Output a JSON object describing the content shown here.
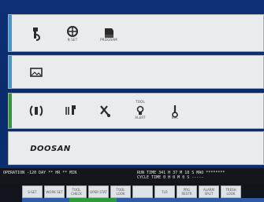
{
  "panels": {
    "top": {
      "icons": [
        {
          "name": "tool-icon",
          "caption": ""
        },
        {
          "name": "network-settings-icon",
          "caption": "N SET"
        },
        {
          "name": "program-icon",
          "caption": "PROGRAM"
        }
      ]
    },
    "display": {
      "icons": [
        {
          "name": "picture-frame-icon",
          "caption": ""
        }
      ]
    },
    "status": {
      "icons": [
        {
          "name": "spindle-icon",
          "caption": ""
        },
        {
          "name": "tool-change-icon",
          "caption": ""
        },
        {
          "name": "coolant-icon",
          "caption": ""
        },
        {
          "name": "light-bulb-icon",
          "caption": "ALERT",
          "caption_top": "TOOL"
        },
        {
          "name": "temperature-icon",
          "caption": "EXC"
        }
      ]
    }
  },
  "brand": {
    "name": "DOOSAN"
  },
  "status_bar": {
    "operation": "OPERATION  -120 DAY  ** HR  ** MIN",
    "run_time": "RUN TIME    341 H 37 M 18 S MAO ********",
    "cycle_time": "CYCLE TIME   0 H  0 M  0 S  -----"
  },
  "softkeys": [
    {
      "label": "S-SET"
    },
    {
      "label": "WORK SET"
    },
    {
      "label": "TOOL CHECK"
    },
    {
      "label": "OPER STAT"
    },
    {
      "label": "TOOL LOOK"
    },
    {
      "label": ""
    },
    {
      "label": "TLR"
    },
    {
      "label": "PRG RESTR"
    },
    {
      "label": "ALARM SPLIT"
    },
    {
      "label": "TRESH LOOK"
    }
  ],
  "colors": {
    "background": "#0b2a6b",
    "panel": "#e9ebec",
    "panel_border": "#a6acb1",
    "accent_blue": "#3e97d6",
    "accent_green": "#2f9a3c",
    "status_bar": "#14161c"
  }
}
